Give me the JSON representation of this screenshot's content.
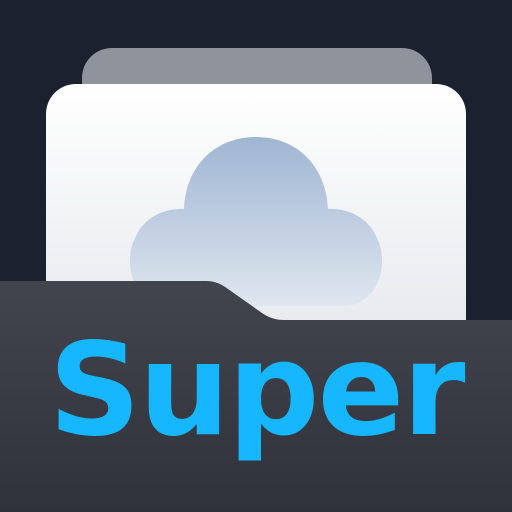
{
  "app_icon": {
    "wordmark": "Super",
    "icon_name": "cloud-folder-icon",
    "colors": {
      "background": "#1c2130",
      "folder_back_sheet": "#8e939c",
      "folder_paper": "#f5f6f8",
      "cloud": "#a9bdd8",
      "folder_front": "#3c3f48",
      "wordmark": "#17b7ff"
    }
  }
}
